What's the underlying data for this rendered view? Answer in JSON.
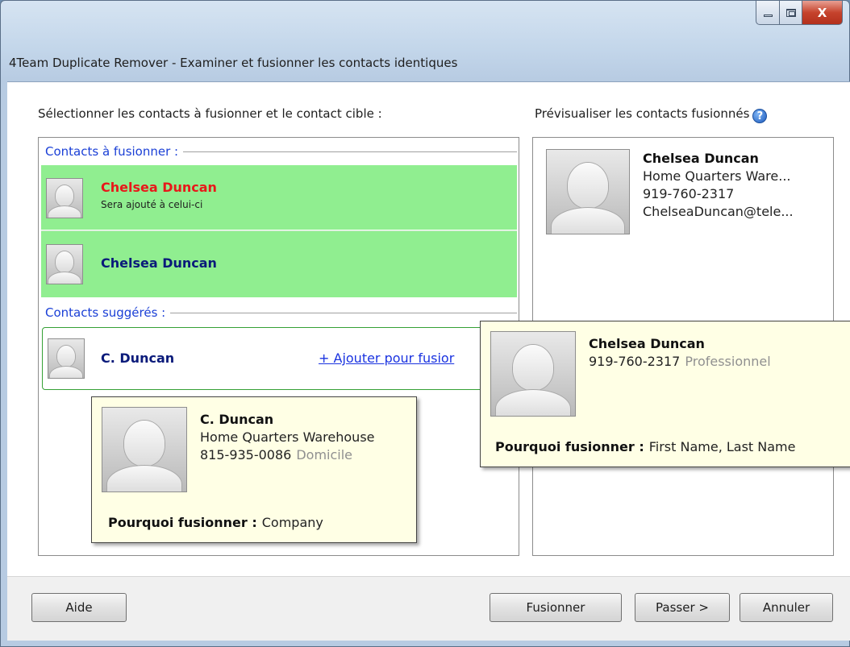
{
  "window": {
    "title": "4Team Duplicate Remover - Examiner et fusionner les contacts identiques",
    "close_glyph": "X"
  },
  "left_panel": {
    "label": "Sélectionner les contacts à fusionner et le contact cible :",
    "merge_group_label": "Contacts à fusionner :",
    "merge_contacts": [
      {
        "name": "Chelsea Duncan",
        "note": "Sera ajouté à celui-ci",
        "name_color": "#e8181a"
      },
      {
        "name": "Chelsea Duncan",
        "note": "",
        "name_color": "#0a1a7a"
      }
    ],
    "suggested_group_label": "Contacts suggérés :",
    "suggested_contacts": [
      {
        "name": "C. Duncan",
        "add_link": "+ Ajouter pour fusior"
      }
    ]
  },
  "right_panel": {
    "label": "Prévisualiser les contacts fusionnés",
    "help_glyph": "?",
    "preview": {
      "name": "Chelsea Duncan",
      "company": "Home Quarters Ware...",
      "phone": "919-760-2317",
      "email": "ChelseaDuncan@tele..."
    }
  },
  "tooltip_suggested": {
    "name": "C. Duncan",
    "company": "Home Quarters Warehouse",
    "phone": "815-935-0086",
    "phone_type": "Domicile",
    "why_label": "Pourquoi fusionner :",
    "why_value": "Company"
  },
  "tooltip_merge": {
    "name": "Chelsea Duncan",
    "phone": "919-760-2317",
    "phone_type": "Professionnel",
    "why_label": "Pourquoi fusionner :",
    "why_value": "First Name, Last Name"
  },
  "footer": {
    "help_button": "Aide",
    "merge_button": "Fusionner",
    "skip_button": "Passer >",
    "cancel_button": "Annuler"
  },
  "colors": {
    "selected_row": "#90ee90",
    "group_header": "#1a3fd6",
    "suggested_border": "#35a035",
    "tooltip_bg": "#ffffe5"
  }
}
